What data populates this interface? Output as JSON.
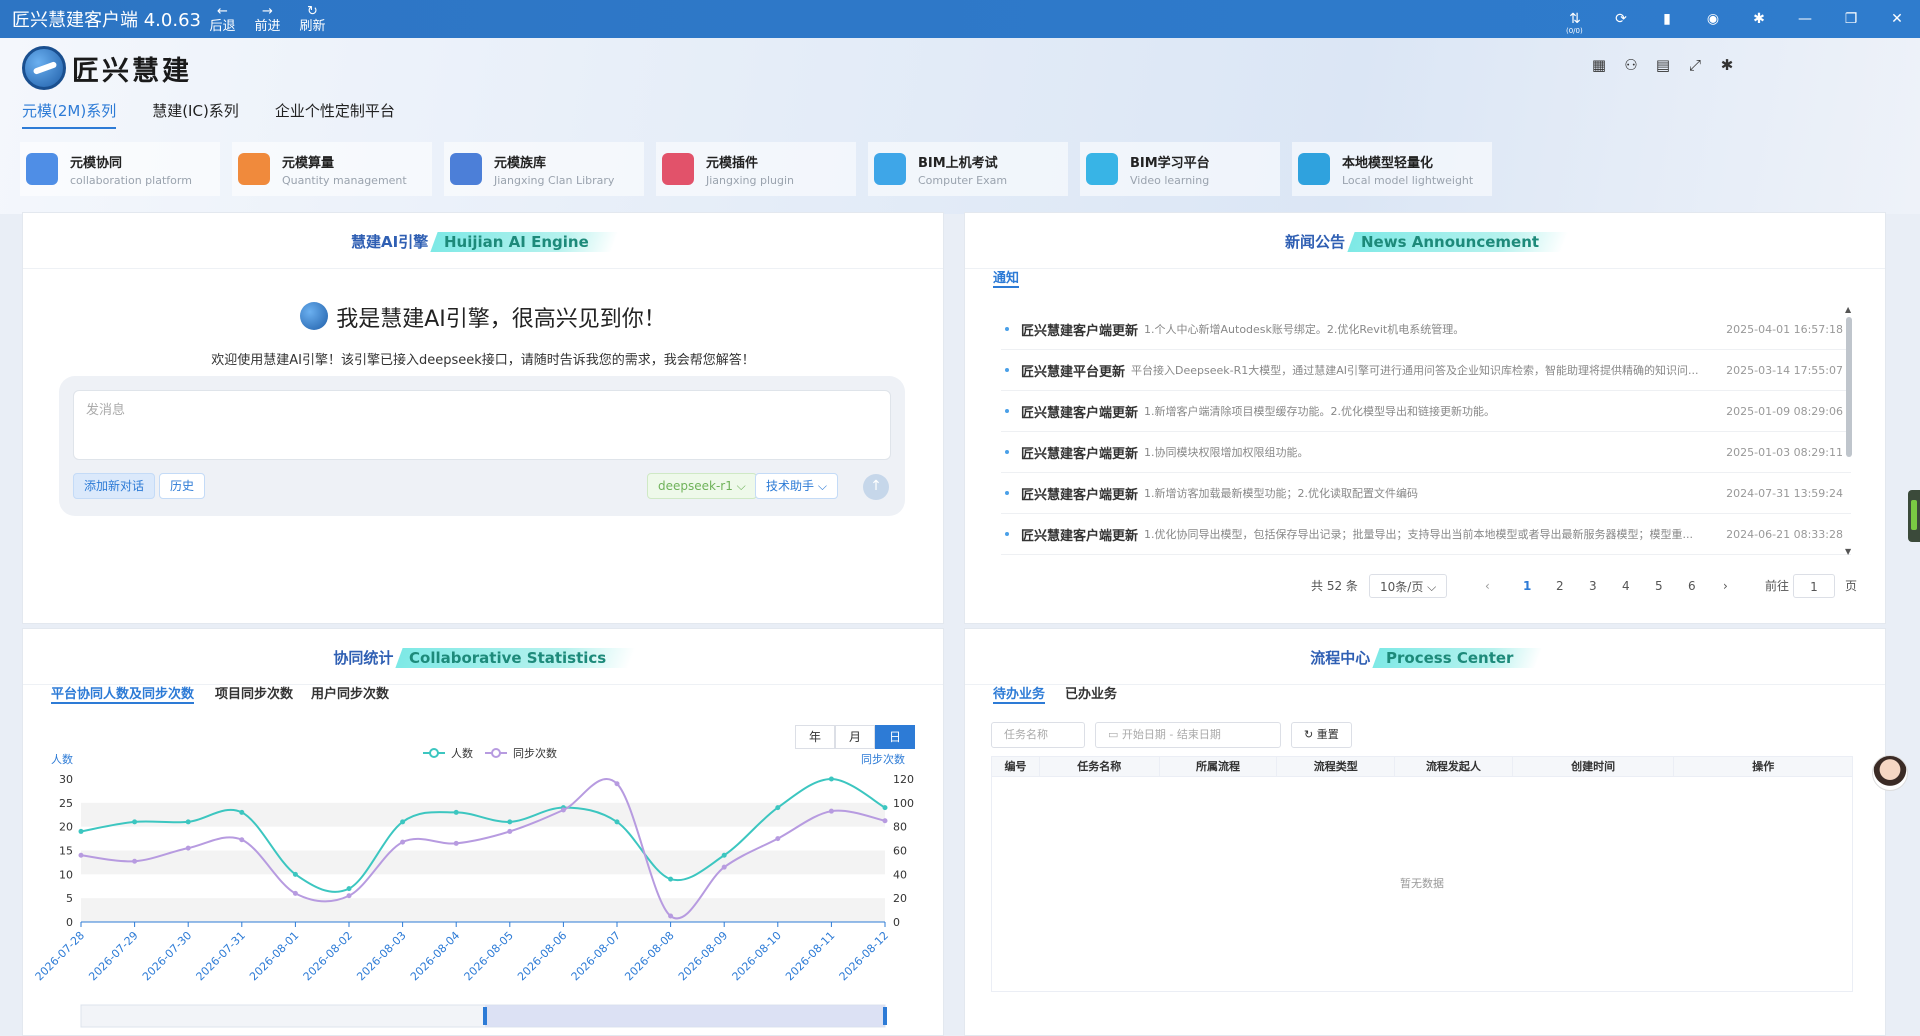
{
  "titlebar": {
    "title": "匠兴慧建客户端 4.0.63",
    "back": "后退",
    "forward": "前进",
    "refresh": "刷新",
    "counter": "(0/0)"
  },
  "logo_text": "匠兴慧建",
  "series_tabs": [
    "元模(2M)系列",
    "慧建(IC)系列",
    "企业个性定制平台"
  ],
  "apps": [
    {
      "name": "元模协同",
      "sub": "collaboration platform",
      "color": "#4f8ee6"
    },
    {
      "name": "元模算量",
      "sub": "Quantity management",
      "color": "#f08a3c"
    },
    {
      "name": "元模族库",
      "sub": "Jiangxing Clan Library",
      "color": "#4c7fd8"
    },
    {
      "name": "元模插件",
      "sub": "Jiangxing plugin",
      "color": "#e2526a"
    },
    {
      "name": "BIM上机考试",
      "sub": "Computer Exam",
      "color": "#3ea6e8"
    },
    {
      "name": "BIM学习平台",
      "sub": "Video learning",
      "color": "#38b4e6"
    },
    {
      "name": "本地模型轻量化",
      "sub": "Local model lightweight",
      "color": "#2fa2de"
    }
  ],
  "ai": {
    "title_cn": "慧建AI引擎",
    "title_en": "Huijian AI Engine",
    "greeting": "我是慧建AI引擎，很高兴见到你！",
    "welcome": "欢迎使用慧建AI引擎！该引擎已接入deepseek接口，请随时告诉我您的需求，我会帮您解答！",
    "placeholder": "发消息",
    "new_chat": "添加新对话",
    "history": "历史",
    "model": "deepseek-r1 ⌵",
    "assistant": "技术助手 ⌵"
  },
  "news": {
    "title_cn": "新闻公告",
    "title_en": "News Announcement",
    "tab": "通知",
    "items": [
      {
        "title": "匠兴慧建客户端更新",
        "desc": "1.个人中心新增Autodesk账号绑定。2.优化Revit机电系统管理。",
        "time": "2025-04-01 16:57:18"
      },
      {
        "title": "匠兴慧建平台更新",
        "desc": "平台接入Deepseek-R1大模型，通过慧建AI引擎可进行通用问答及企业知识库检索，智能助理将提供精确的知识问...",
        "time": "2025-03-14 17:55:07"
      },
      {
        "title": "匠兴慧建客户端更新",
        "desc": "1.新增客户端清除项目模型缓存功能。2.优化模型导出和链接更新功能。",
        "time": "2025-01-09 08:29:06"
      },
      {
        "title": "匠兴慧建客户端更新",
        "desc": "1.协同模块权限增加权限组功能。",
        "time": "2025-01-03 08:29:11"
      },
      {
        "title": "匠兴慧建客户端更新",
        "desc": "1.新增访客加载最新模型功能；2.优化读取配置文件编码",
        "time": "2024-07-31 13:59:24"
      },
      {
        "title": "匠兴慧建客户端更新",
        "desc": "1.优化协同导出模型，包括保存导出记录；批量导出；支持导出当前本地模型或者导出最新服务器模型；模型重...",
        "time": "2024-06-21 08:33:28"
      }
    ],
    "total": "共 52 条",
    "page_size": "10条/页 ⌵",
    "pages": [
      "1",
      "2",
      "3",
      "4",
      "5",
      "6"
    ],
    "goto": "前往",
    "goto_value": "1",
    "page_unit": "页"
  },
  "stats": {
    "title_cn": "协同统计",
    "title_en": "Collaborative Statistics",
    "tabs": [
      "平台协同人数及同步次数",
      "项目同步次数",
      "用户同步次数"
    ],
    "periods": [
      "年",
      "月",
      "日"
    ]
  },
  "process": {
    "title_cn": "流程中心",
    "title_en": "Process Center",
    "tabs": [
      "待办业务",
      "已办业务"
    ],
    "task_placeholder": "任务名称",
    "start_date": "开始日期",
    "date_sep": "-",
    "end_date": "结束日期",
    "reset": "重置",
    "columns": [
      "编号",
      "任务名称",
      "所属流程",
      "流程类型",
      "流程发起人",
      "创建时间",
      "操作"
    ],
    "empty": "暂无数据"
  },
  "chart_data": {
    "type": "line",
    "x": [
      "2026-07-28",
      "2026-07-29",
      "2026-07-30",
      "2026-07-31",
      "2026-08-01",
      "2026-08-02",
      "2026-08-03",
      "2026-08-04",
      "2026-08-05",
      "2026-08-06",
      "2026-08-07",
      "2026-08-08",
      "2026-08-09",
      "2026-08-10",
      "2026-08-11",
      "2026-08-12"
    ],
    "series": [
      {
        "name": "人数",
        "axis": "left",
        "color": "#3cc6c0",
        "values": [
          19,
          21,
          21,
          23,
          10,
          7,
          21,
          23,
          21,
          24,
          21,
          9,
          14,
          24,
          30,
          24
        ]
      },
      {
        "name": "同步次数",
        "axis": "right",
        "color": "#b79be0",
        "values": [
          56,
          51,
          62,
          69,
          24,
          22,
          67,
          66,
          76,
          94,
          116,
          5,
          46,
          70,
          93,
          85
        ]
      }
    ],
    "ylabel": "人数",
    "ylabel_right": "同步次数",
    "ylim": [
      0,
      30
    ],
    "ylim_right": [
      0,
      120
    ],
    "yticks": [
      0,
      5,
      10,
      15,
      20,
      25,
      30
    ],
    "yticks_right": [
      0,
      20,
      40,
      60,
      80,
      100,
      120
    ],
    "legend": "top-center",
    "grid": true
  }
}
